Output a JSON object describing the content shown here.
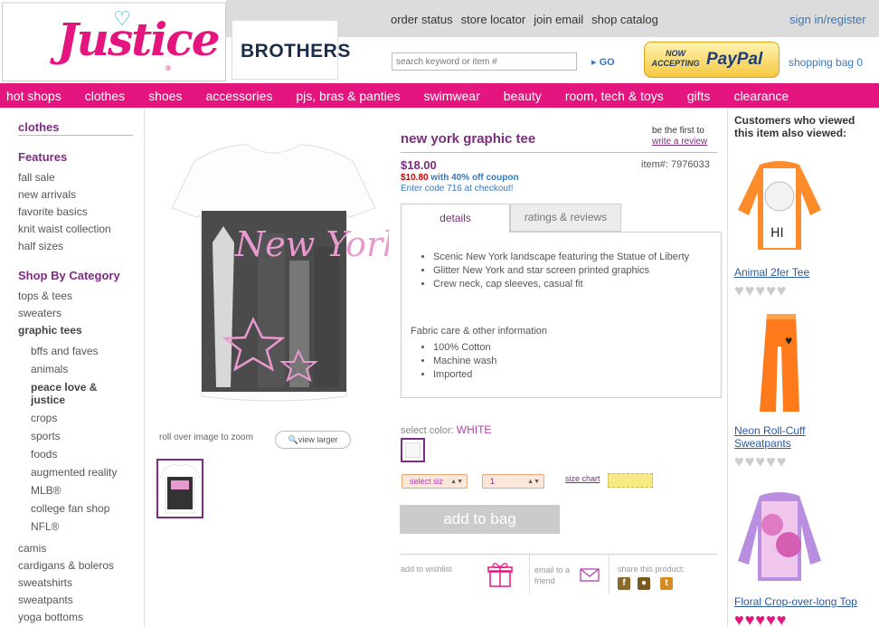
{
  "brand": {
    "logo": "Justice",
    "brothers": "BROTHERS"
  },
  "header": {
    "top_links": [
      "order status",
      "store locator",
      "join email",
      "shop catalog"
    ],
    "sign_in": "sign in/register",
    "search_placeholder": "search keyword or item #",
    "go": "GO",
    "paypal_now": "NOW ACCEPTING",
    "paypal_logo": "PayPal",
    "shopping_bag": "shopping bag 0"
  },
  "nav": [
    "hot shops",
    "clothes",
    "shoes",
    "accessories",
    "pjs, bras & panties",
    "swimwear",
    "beauty",
    "room, tech & toys",
    "gifts",
    "clearance"
  ],
  "sidebar": {
    "title": "clothes",
    "features_heading": "Features",
    "features": [
      "fall sale",
      "new arrivals",
      "favorite basics",
      "knit waist collection",
      "half sizes"
    ],
    "category_heading": "Shop By Category",
    "categories_top": [
      "tops & tees",
      "sweaters"
    ],
    "current_category": "graphic tees",
    "subcategories": [
      "bffs and faves",
      "animals",
      "peace love & justice",
      "crops",
      "sports",
      "foods",
      "augmented reality",
      "MLB®",
      "college fan shop",
      "NFL®"
    ],
    "categories_bottom": [
      "camis",
      "cardigans & boleros",
      "sweatshirts",
      "sweatpants",
      "yoga bottoms"
    ]
  },
  "product": {
    "name": "new york graphic tee",
    "review_prompt": "be the first to",
    "review_link": "write a review",
    "price": "$18.00",
    "sale_price": "$10.80",
    "coupon_text": "with 40% off coupon",
    "code_text": "Enter code 716 at checkout!",
    "item_number": "item#: 7976033",
    "zoom_label": "roll over image to zoom",
    "view_larger": "view larger",
    "tabs": [
      "details",
      "ratings & reviews"
    ],
    "features": [
      "Scenic New York landscape featuring the Statue of Liberty",
      "Glitter New York and star screen printed graphics",
      "Crew neck, cap sleeves, casual fit"
    ],
    "care_heading": "Fabric care & other information",
    "care": [
      "100% Cotton",
      "Machine wash",
      "Imported"
    ],
    "select_color_label": "select color:",
    "color": "WHITE",
    "size_select": "select siz",
    "qty_select": "1",
    "size_chart": "size chart",
    "add_to_bag": "add to bag",
    "add_wishlist": "add to wishlist",
    "email_friend": "email to a friend",
    "share": "share this product:",
    "shirt_text": "New York"
  },
  "recently_viewed": {
    "title": "Customers who viewed this item also viewed:",
    "items": [
      {
        "name": "Animal 2fer Tee",
        "rating": 0,
        "hearts": 5
      },
      {
        "name": "Neon Roll-Cuff Sweatpants",
        "rating": 0,
        "hearts": 5
      },
      {
        "name": "Floral Crop-over-long Top",
        "rating": 5,
        "hearts": 5
      }
    ]
  },
  "colors": {
    "brand_pink": "#e4157e",
    "purple": "#7b2d7f",
    "link_blue": "#3a77b8"
  }
}
